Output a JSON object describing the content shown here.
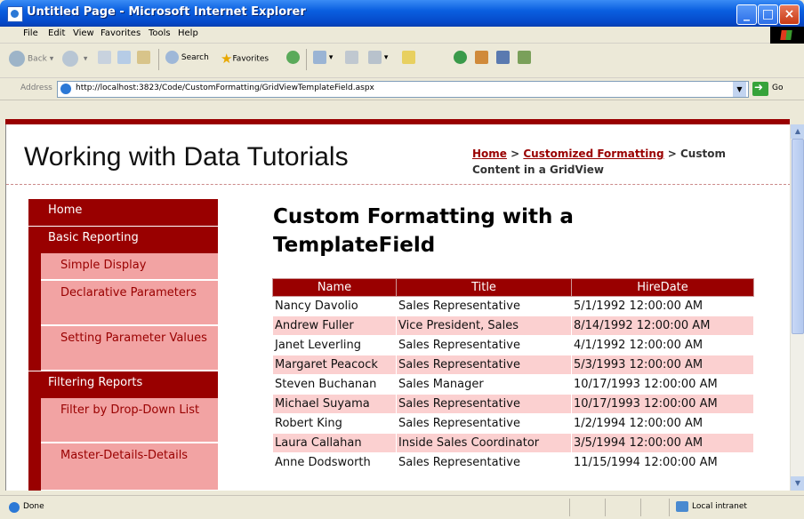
{
  "window": {
    "title": "Untitled Page - Microsoft Internet Explorer"
  },
  "menu": [
    "File",
    "Edit",
    "View",
    "Favorites",
    "Tools",
    "Help"
  ],
  "toolbar": {
    "back_label": "Back",
    "search_label": "Search",
    "favorites_label": "Favorites"
  },
  "address": {
    "label": "Address",
    "url": "http://localhost:3823/Code/CustomFormatting/GridViewTemplateField.aspx",
    "go_label": "Go"
  },
  "site": {
    "title": "Working with Data Tutorials"
  },
  "breadcrumb": {
    "home": "Home",
    "sep": " > ",
    "section": "Customized Formatting",
    "current": "Custom Content in a GridView"
  },
  "sidebar": {
    "home": "Home",
    "basic_reporting": "Basic Reporting",
    "simple_display": "Simple Display",
    "declarative_parameters": "Declarative Parameters",
    "setting_parameter_values": "Setting Parameter Values",
    "filtering_reports": "Filtering Reports",
    "filter_dropdown": "Filter by Drop-Down List",
    "master_details": "Master-Details-Details"
  },
  "main": {
    "title": "Custom Formatting with a TemplateField"
  },
  "grid": {
    "columns": [
      "Name",
      "Title",
      "HireDate"
    ],
    "rows": [
      [
        "Nancy Davolio",
        "Sales Representative",
        "5/1/1992 12:00:00 AM"
      ],
      [
        "Andrew Fuller",
        "Vice President, Sales",
        "8/14/1992 12:00:00 AM"
      ],
      [
        "Janet Leverling",
        "Sales Representative",
        "4/1/1992 12:00:00 AM"
      ],
      [
        "Margaret Peacock",
        "Sales Representative",
        "5/3/1993 12:00:00 AM"
      ],
      [
        "Steven Buchanan",
        "Sales Manager",
        "10/17/1993 12:00:00 AM"
      ],
      [
        "Michael Suyama",
        "Sales Representative",
        "10/17/1993 12:00:00 AM"
      ],
      [
        "Robert King",
        "Sales Representative",
        "1/2/1994 12:00:00 AM"
      ],
      [
        "Laura Callahan",
        "Inside Sales Coordinator",
        "3/5/1994 12:00:00 AM"
      ],
      [
        "Anne Dodsworth",
        "Sales Representative",
        "11/15/1994 12:00:00 AM"
      ]
    ]
  },
  "status": {
    "text": "Done",
    "zone": "Local intranet"
  },
  "colors": {
    "accent": "#990000",
    "sub_nav": "#f2a3a3",
    "alt_row": "#fbd0d0"
  }
}
